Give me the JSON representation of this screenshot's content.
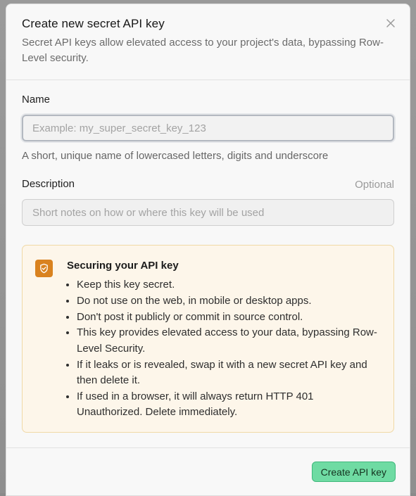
{
  "dialog": {
    "title": "Create new secret API key",
    "subtitle": "Secret API keys allow elevated access to your project's data, bypassing Row-Level security."
  },
  "name_field": {
    "label": "Name",
    "placeholder": "Example: my_super_secret_key_123",
    "value": "",
    "hint": "A short, unique name of lowercased letters, digits and underscore"
  },
  "description_field": {
    "label": "Description",
    "optional_label": "Optional",
    "placeholder": "Short notes on how or where this key will be used",
    "value": ""
  },
  "callout": {
    "icon": "shield-check-icon",
    "title": "Securing your API key",
    "items": [
      "Keep this key secret.",
      "Do not use on the web, in mobile or desktop apps.",
      "Don't post it publicly or commit in source control.",
      "This key provides elevated access to your data, bypassing Row-Level Security.",
      "If it leaks or is revealed, swap it with a new secret API key and then delete it.",
      "If used in a browser, it will always return HTTP 401 Unauthorized. Delete immediately."
    ]
  },
  "footer": {
    "create_label": "Create API key"
  },
  "colors": {
    "accent": "#6fdba3",
    "warning": "#d9821f",
    "callout_bg": "#fdf6ea"
  }
}
